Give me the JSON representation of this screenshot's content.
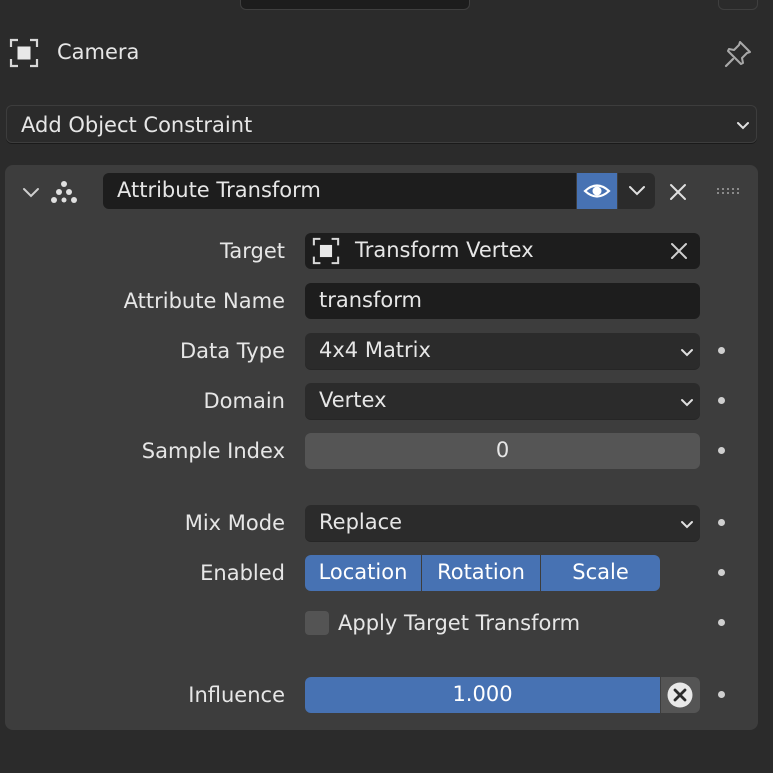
{
  "header": {
    "title": "Camera"
  },
  "add_constraint": {
    "label": "Add Object Constraint"
  },
  "constraint": {
    "name": "Attribute Transform",
    "fields": {
      "target_label": "Target",
      "target_value": "Transform Vertex",
      "attribute_name_label": "Attribute Name",
      "attribute_name_value": "transform",
      "data_type_label": "Data Type",
      "data_type_value": "4x4 Matrix",
      "domain_label": "Domain",
      "domain_value": "Vertex",
      "sample_index_label": "Sample Index",
      "sample_index_value": "0",
      "mix_mode_label": "Mix Mode",
      "mix_mode_value": "Replace",
      "enabled_label": "Enabled",
      "enabled_options": [
        "Location",
        "Rotation",
        "Scale"
      ],
      "apply_target_transform_label": "Apply Target Transform",
      "influence_label": "Influence",
      "influence_value": "1.000"
    }
  },
  "colors": {
    "background": "#2b2b2b",
    "panel": "#3d3d3d",
    "field": "#1d1d1d",
    "accent": "#4772b3"
  }
}
